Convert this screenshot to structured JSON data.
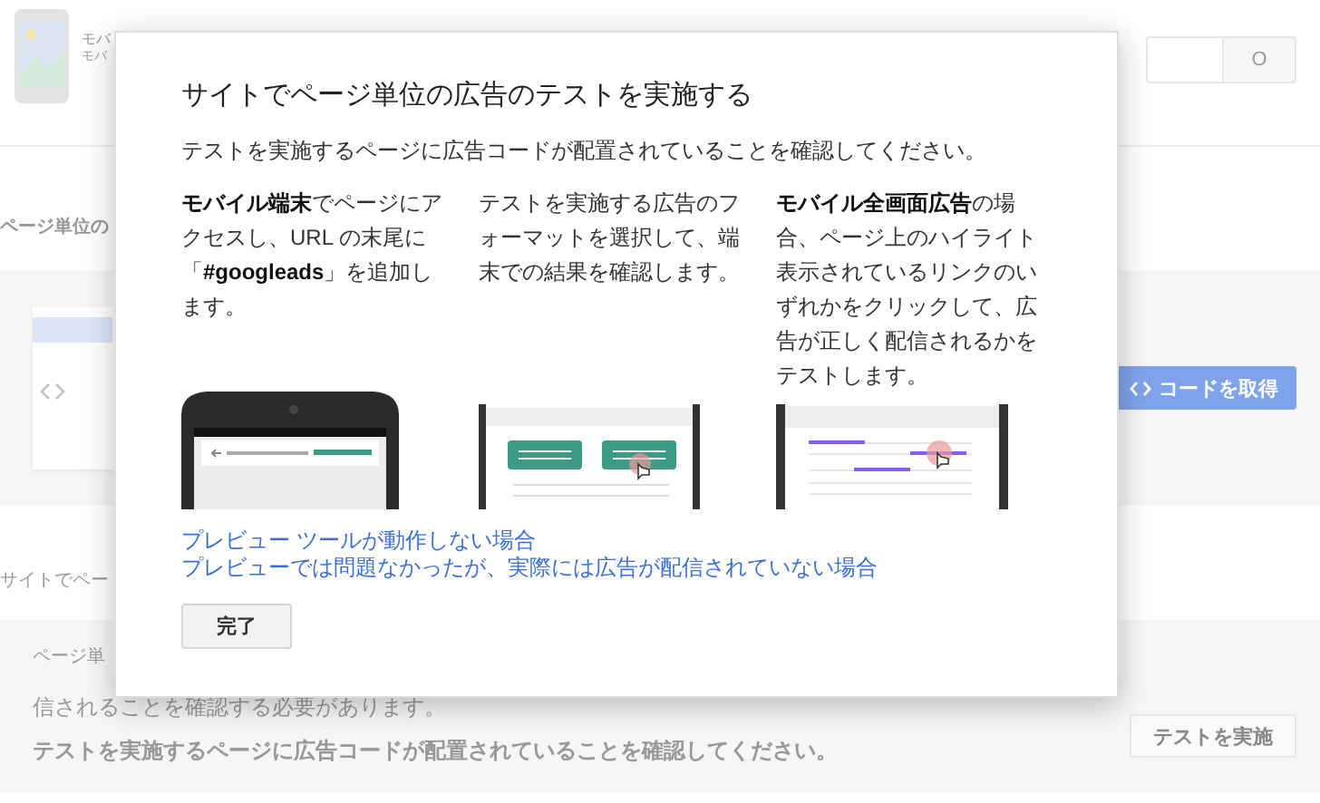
{
  "header": {
    "title": "モバ",
    "subtitle": "モバ",
    "button": "O"
  },
  "section_1": {
    "label": "ページ単位の",
    "button": "コードを取得"
  },
  "section_2": {
    "label": "サイトでペー",
    "note_start": "ページ単",
    "note_end": "信されることを確認する必要があります。",
    "instruction": "テストを実施するページに広告コードが配置されていることを確認してください。",
    "button": "テストを実施"
  },
  "dialog": {
    "title": "サイトでページ単位の広告のテストを実施する",
    "intro": "テストを実施するページに広告コードが配置されていることを確認してください。",
    "steps": [
      {
        "kind": "phone",
        "text": "**モバイル端末**でページにアクセスし、URL の末尾に「**#googleads**」を追加します。"
      },
      {
        "kind": "format",
        "text": "テストを実施する広告のフォーマットを選択して、端末での結果を確認します。"
      },
      {
        "kind": "links",
        "text": "**モバイル全画面広告**の場合、ページ上のハイライト表示されているリンクのいずれかをクリックして、広告が正しく配信されるかをテストします。"
      }
    ],
    "links": [
      "プレビュー ツールが動作しない場合",
      "プレビューでは問題なかったが、実際には広告が配信されていない場合"
    ],
    "button": "完了"
  }
}
